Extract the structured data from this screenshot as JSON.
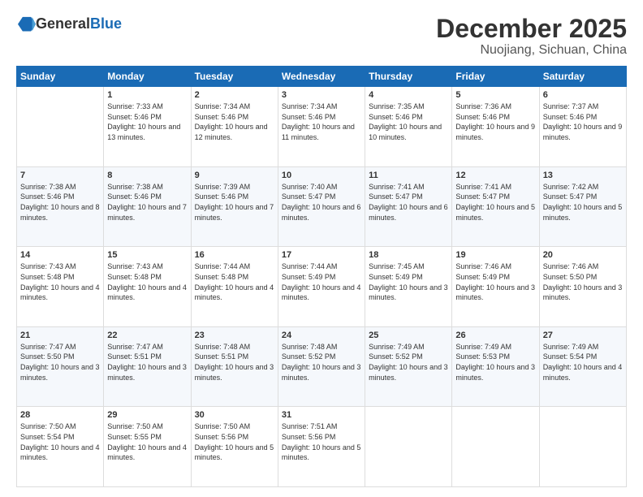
{
  "header": {
    "logo_general": "General",
    "logo_blue": "Blue",
    "month": "December 2025",
    "location": "Nuojiang, Sichuan, China"
  },
  "weekdays": [
    "Sunday",
    "Monday",
    "Tuesday",
    "Wednesday",
    "Thursday",
    "Friday",
    "Saturday"
  ],
  "weeks": [
    [
      {
        "day": "",
        "info": ""
      },
      {
        "day": "1",
        "info": "Sunrise: 7:33 AM\nSunset: 5:46 PM\nDaylight: 10 hours\nand 13 minutes."
      },
      {
        "day": "2",
        "info": "Sunrise: 7:34 AM\nSunset: 5:46 PM\nDaylight: 10 hours\nand 12 minutes."
      },
      {
        "day": "3",
        "info": "Sunrise: 7:34 AM\nSunset: 5:46 PM\nDaylight: 10 hours\nand 11 minutes."
      },
      {
        "day": "4",
        "info": "Sunrise: 7:35 AM\nSunset: 5:46 PM\nDaylight: 10 hours\nand 10 minutes."
      },
      {
        "day": "5",
        "info": "Sunrise: 7:36 AM\nSunset: 5:46 PM\nDaylight: 10 hours\nand 9 minutes."
      },
      {
        "day": "6",
        "info": "Sunrise: 7:37 AM\nSunset: 5:46 PM\nDaylight: 10 hours\nand 9 minutes."
      }
    ],
    [
      {
        "day": "7",
        "info": "Sunrise: 7:38 AM\nSunset: 5:46 PM\nDaylight: 10 hours\nand 8 minutes."
      },
      {
        "day": "8",
        "info": "Sunrise: 7:38 AM\nSunset: 5:46 PM\nDaylight: 10 hours\nand 7 minutes."
      },
      {
        "day": "9",
        "info": "Sunrise: 7:39 AM\nSunset: 5:46 PM\nDaylight: 10 hours\nand 7 minutes."
      },
      {
        "day": "10",
        "info": "Sunrise: 7:40 AM\nSunset: 5:47 PM\nDaylight: 10 hours\nand 6 minutes."
      },
      {
        "day": "11",
        "info": "Sunrise: 7:41 AM\nSunset: 5:47 PM\nDaylight: 10 hours\nand 6 minutes."
      },
      {
        "day": "12",
        "info": "Sunrise: 7:41 AM\nSunset: 5:47 PM\nDaylight: 10 hours\nand 5 minutes."
      },
      {
        "day": "13",
        "info": "Sunrise: 7:42 AM\nSunset: 5:47 PM\nDaylight: 10 hours\nand 5 minutes."
      }
    ],
    [
      {
        "day": "14",
        "info": "Sunrise: 7:43 AM\nSunset: 5:48 PM\nDaylight: 10 hours\nand 4 minutes."
      },
      {
        "day": "15",
        "info": "Sunrise: 7:43 AM\nSunset: 5:48 PM\nDaylight: 10 hours\nand 4 minutes."
      },
      {
        "day": "16",
        "info": "Sunrise: 7:44 AM\nSunset: 5:48 PM\nDaylight: 10 hours\nand 4 minutes."
      },
      {
        "day": "17",
        "info": "Sunrise: 7:44 AM\nSunset: 5:49 PM\nDaylight: 10 hours\nand 4 minutes."
      },
      {
        "day": "18",
        "info": "Sunrise: 7:45 AM\nSunset: 5:49 PM\nDaylight: 10 hours\nand 3 minutes."
      },
      {
        "day": "19",
        "info": "Sunrise: 7:46 AM\nSunset: 5:49 PM\nDaylight: 10 hours\nand 3 minutes."
      },
      {
        "day": "20",
        "info": "Sunrise: 7:46 AM\nSunset: 5:50 PM\nDaylight: 10 hours\nand 3 minutes."
      }
    ],
    [
      {
        "day": "21",
        "info": "Sunrise: 7:47 AM\nSunset: 5:50 PM\nDaylight: 10 hours\nand 3 minutes."
      },
      {
        "day": "22",
        "info": "Sunrise: 7:47 AM\nSunset: 5:51 PM\nDaylight: 10 hours\nand 3 minutes."
      },
      {
        "day": "23",
        "info": "Sunrise: 7:48 AM\nSunset: 5:51 PM\nDaylight: 10 hours\nand 3 minutes."
      },
      {
        "day": "24",
        "info": "Sunrise: 7:48 AM\nSunset: 5:52 PM\nDaylight: 10 hours\nand 3 minutes."
      },
      {
        "day": "25",
        "info": "Sunrise: 7:49 AM\nSunset: 5:52 PM\nDaylight: 10 hours\nand 3 minutes."
      },
      {
        "day": "26",
        "info": "Sunrise: 7:49 AM\nSunset: 5:53 PM\nDaylight: 10 hours\nand 3 minutes."
      },
      {
        "day": "27",
        "info": "Sunrise: 7:49 AM\nSunset: 5:54 PM\nDaylight: 10 hours\nand 4 minutes."
      }
    ],
    [
      {
        "day": "28",
        "info": "Sunrise: 7:50 AM\nSunset: 5:54 PM\nDaylight: 10 hours\nand 4 minutes."
      },
      {
        "day": "29",
        "info": "Sunrise: 7:50 AM\nSunset: 5:55 PM\nDaylight: 10 hours\nand 4 minutes."
      },
      {
        "day": "30",
        "info": "Sunrise: 7:50 AM\nSunset: 5:56 PM\nDaylight: 10 hours\nand 5 minutes."
      },
      {
        "day": "31",
        "info": "Sunrise: 7:51 AM\nSunset: 5:56 PM\nDaylight: 10 hours\nand 5 minutes."
      },
      {
        "day": "",
        "info": ""
      },
      {
        "day": "",
        "info": ""
      },
      {
        "day": "",
        "info": ""
      }
    ]
  ]
}
